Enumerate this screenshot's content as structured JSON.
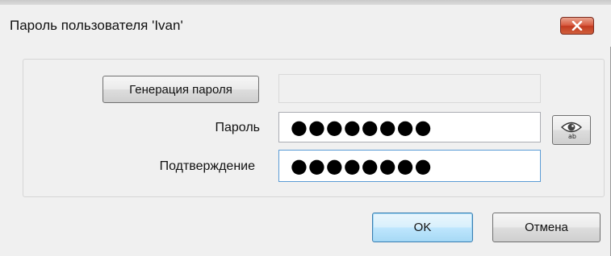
{
  "window": {
    "title": "Пароль пользователя 'Ivan'"
  },
  "form": {
    "generate_button_label": "Генерация пароля",
    "generated_value": "",
    "password_label": "Пароль",
    "password_value": "●●●●●●●●",
    "confirm_label": "Подтверждение",
    "confirm_value": "●●●●●●●●"
  },
  "footer": {
    "ok_label": "OK",
    "cancel_label": "Отмена"
  },
  "icons": {
    "close": "close-icon",
    "show_password": "eye-icon"
  },
  "colors": {
    "close_button": "#d0503a",
    "default_button": "#bee6fd"
  }
}
